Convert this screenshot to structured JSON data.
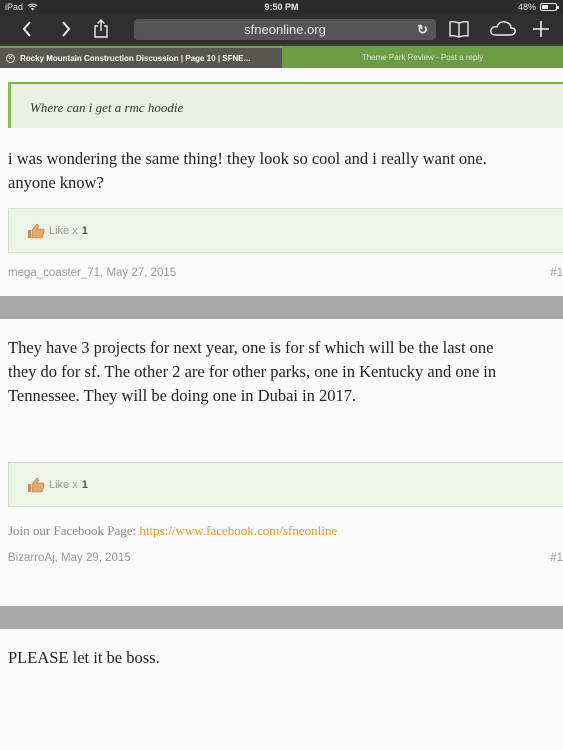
{
  "status_bar": {
    "device": "iPad",
    "time": "9:50 PM",
    "battery": "48%",
    "battery_level": 0.48
  },
  "toolbar": {
    "url": "sfneonline.org",
    "icons": [
      "back-icon",
      "forward-icon",
      "share-icon",
      "reload-icon",
      "bookmarks-icon",
      "icloud-tabs-icon",
      "new-tab-icon"
    ]
  },
  "tabs": [
    {
      "label": "Rocky Mountain Construction Discussion | Page 10 | SFNE...",
      "active": true
    },
    {
      "label": "Theme Park Review - Post a reply",
      "active": false
    }
  ],
  "posts": [
    {
      "quote": "Where can i get a rmc hoodie",
      "message_lines": [
        "i was wondering the same thing! they look so cool and i really want one.",
        "anyone know?"
      ],
      "like_label": "Like x",
      "like_count": "1",
      "author_date": "mega_coaster_71, May 27, 2015",
      "post_number": "#1"
    },
    {
      "message_lines": [
        "They have 3 projects for next year, one is for sf which will be the last one",
        "they do for sf. The other 2 are for other parks, one in Kentucky and one in",
        "Tennessee. They will be doing one in Dubai in 2017."
      ],
      "like_label": "Like x",
      "like_count": "1",
      "signature_text": "Join our Facebook Page:",
      "signature_link": "https://www.facebook.com/sfneonline",
      "author_date": "BizarroAj, May 29, 2015",
      "post_number": "#1"
    },
    {
      "message_lines": [
        "PLEASE let it be boss."
      ]
    }
  ],
  "colors": {
    "accent_green": "#7fb14c",
    "link_orange": "#e59a23",
    "separator_gray": "#a9a9a9"
  }
}
